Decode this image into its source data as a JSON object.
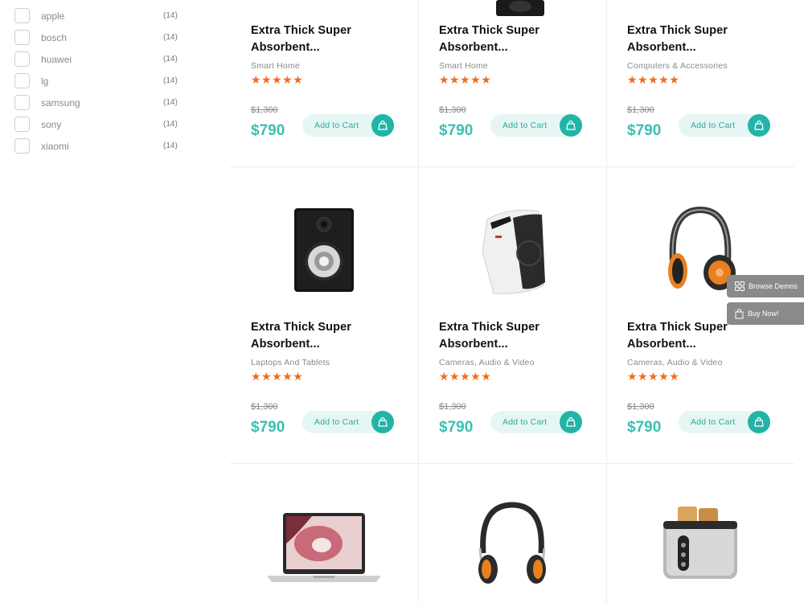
{
  "brands": [
    {
      "label": "apple",
      "count": "(14)"
    },
    {
      "label": "bosch",
      "count": "(14)"
    },
    {
      "label": "huawei",
      "count": "(14)"
    },
    {
      "label": "lg",
      "count": "(14)"
    },
    {
      "label": "samsung",
      "count": "(14)"
    },
    {
      "label": "sony",
      "count": "(14)"
    },
    {
      "label": "xiaomi",
      "count": "(14)"
    }
  ],
  "products": [
    {
      "title": "Extra Thick Super Absorbent...",
      "category": "Smart Home",
      "rating": 5,
      "old_price": "$1,300",
      "price": "$790",
      "cart_label": "Add to Cart",
      "image": "box-icon"
    },
    {
      "title": "Extra Thick Super Absorbent...",
      "category": "Smart Home",
      "rating": 5,
      "old_price": "$1,300",
      "price": "$790",
      "cart_label": "Add to Cart",
      "image": "speaker-icon"
    },
    {
      "title": "Extra Thick Super Absorbent...",
      "category": "Computers & Accessories",
      "rating": 5,
      "old_price": "$1,300",
      "price": "$790",
      "cart_label": "Add to Cart",
      "image": ""
    },
    {
      "title": "Extra Thick Super Absorbent...",
      "category": "Laptops And Tablets",
      "rating": 5,
      "old_price": "$1,300",
      "price": "$790",
      "cart_label": "Add to Cart",
      "image": "speaker-icon"
    },
    {
      "title": "Extra Thick Super Absorbent...",
      "category": "Cameras, Audio & Video",
      "rating": 5,
      "old_price": "$1,300",
      "price": "$790",
      "cart_label": "Add to Cart",
      "image": "shredder-icon"
    },
    {
      "title": "Extra Thick Super Absorbent...",
      "category": "Cameras, Audio & Video",
      "rating": 5,
      "old_price": "$1,300",
      "price": "$790",
      "cart_label": "Add to Cart",
      "image": "headphones-icon"
    },
    {
      "image": "laptop-icon"
    },
    {
      "image": "headphones-icon"
    },
    {
      "image": "toaster-icon"
    }
  ],
  "stars_text": "★★★★★",
  "side_buttons": {
    "browse_demos": "Browse Demos",
    "buy_now": "Buy Now!"
  },
  "colors": {
    "accent": "#22b4a6",
    "price": "#3bbfb2",
    "stars": "#f26b1d"
  }
}
